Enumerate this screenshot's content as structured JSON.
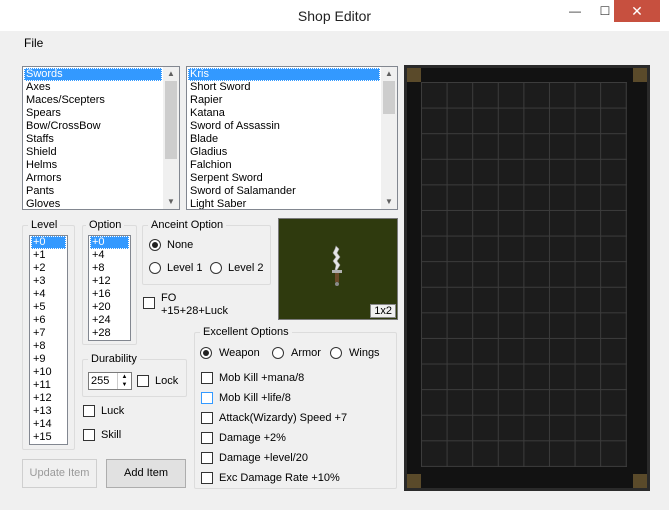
{
  "window": {
    "title": "Shop Editor",
    "minimize": "—",
    "maximize": "☐",
    "close": "✕"
  },
  "menu": {
    "file": "File"
  },
  "categories": {
    "items": [
      "Swords",
      "Axes",
      "Maces/Scepters",
      "Spears",
      "Bow/CrossBow",
      "Staffs",
      "Shield",
      "Helms",
      "Armors",
      "Pants",
      "Gloves"
    ],
    "selected": 0
  },
  "items": {
    "items": [
      "Kris",
      "Short Sword",
      "Rapier",
      "Katana",
      "Sword of Assassin",
      "Blade",
      "Gladius",
      "Falchion",
      "Serpent Sword",
      "Sword of Salamander",
      "Light Saber"
    ],
    "selected": 0
  },
  "level": {
    "label": "Level",
    "items": [
      "+0",
      "+1",
      "+2",
      "+3",
      "+4",
      "+5",
      "+6",
      "+7",
      "+8",
      "+9",
      "+10",
      "+11",
      "+12",
      "+13",
      "+14",
      "+15"
    ],
    "selected": 0
  },
  "option": {
    "label": "Option",
    "items": [
      "+0",
      "+4",
      "+8",
      "+12",
      "+16",
      "+20",
      "+24",
      "+28"
    ],
    "selected": 0
  },
  "ancient": {
    "label": "Anceint Option",
    "none": "None",
    "level1": "Level 1",
    "level2": "Level 2",
    "selected": "none"
  },
  "fo": {
    "label": "FO",
    "sublabel": "+15+28+Luck",
    "checked": false
  },
  "preview": {
    "size_label": "1x2",
    "item_icon": "kris-dagger-icon"
  },
  "durability": {
    "label": "Durability",
    "value": "255",
    "lock_label": "Lock",
    "lock_checked": false
  },
  "luck": {
    "label": "Luck",
    "checked": false
  },
  "skill": {
    "label": "Skill",
    "checked": false
  },
  "excellent": {
    "label": "Excellent Options",
    "types": [
      "Weapon",
      "Armor",
      "Wings"
    ],
    "selected_type": "Weapon",
    "options": [
      "Mob Kill +mana/8",
      "Mob Kill +life/8",
      "Attack(Wizardy) Speed +7",
      "Damage +2%",
      "Damage +level/20",
      "Exc Damage Rate +10%"
    ]
  },
  "buttons": {
    "update": "Update Item",
    "add": "Add Item"
  },
  "colors": {
    "selection": "#3399ff",
    "close_button": "#c7503f",
    "preview_bg": "#2f3a0e",
    "inventory_bg": "#1c1c1c"
  }
}
